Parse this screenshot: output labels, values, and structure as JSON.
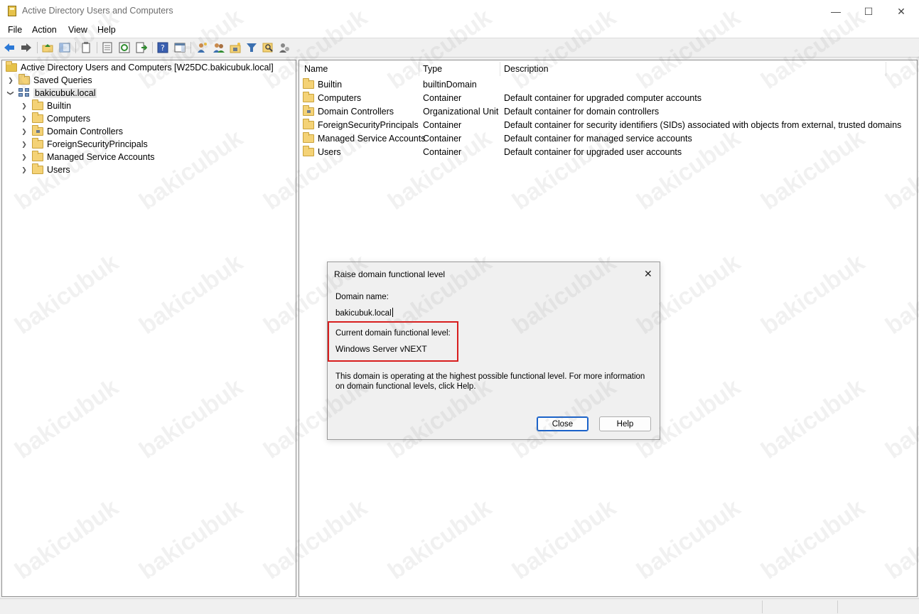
{
  "window": {
    "title": "Active Directory Users and Computers",
    "minimize_glyph": "—",
    "maximize_glyph": "☐",
    "close_glyph": "✕"
  },
  "menu": [
    "File",
    "Action",
    "View",
    "Help"
  ],
  "tree": {
    "root_label": "Active Directory Users and Computers [W25DC.bakicubuk.local]",
    "saved_queries": "Saved Queries",
    "domain": "bakicubuk.local",
    "children": [
      "Builtin",
      "Computers",
      "Domain Controllers",
      "ForeignSecurityPrincipals",
      "Managed Service Accounts",
      "Users"
    ]
  },
  "list": {
    "columns": [
      "Name",
      "Type",
      "Description"
    ],
    "rows": [
      {
        "name": "Builtin",
        "type": "builtinDomain",
        "description": ""
      },
      {
        "name": "Computers",
        "type": "Container",
        "description": "Default container for upgraded computer accounts"
      },
      {
        "name": "Domain Controllers",
        "type": "Organizational Unit",
        "description": "Default container for domain controllers"
      },
      {
        "name": "ForeignSecurityPrincipals",
        "type": "Container",
        "description": "Default container for security identifiers (SIDs) associated with objects from external, trusted domains"
      },
      {
        "name": "Managed Service Accounts",
        "type": "Container",
        "description": "Default container for managed service accounts"
      },
      {
        "name": "Users",
        "type": "Container",
        "description": "Default container for upgraded user accounts"
      }
    ]
  },
  "dialog": {
    "title": "Raise domain functional level",
    "domain_name_label": "Domain name:",
    "domain_name_value": "bakicubuk.local",
    "current_level_label": "Current domain functional level:",
    "current_level_value": "Windows Server vNEXT",
    "info_text": "This domain is operating at the highest possible functional level. For more information on domain functional levels, click Help.",
    "close_button": "Close",
    "help_button": "Help",
    "close_glyph": "✕"
  },
  "watermark": "bakicubuk",
  "colors": {
    "highlight": "#d81e1e",
    "default_button_border": "#1a62c9",
    "folder": "#f4d276"
  }
}
